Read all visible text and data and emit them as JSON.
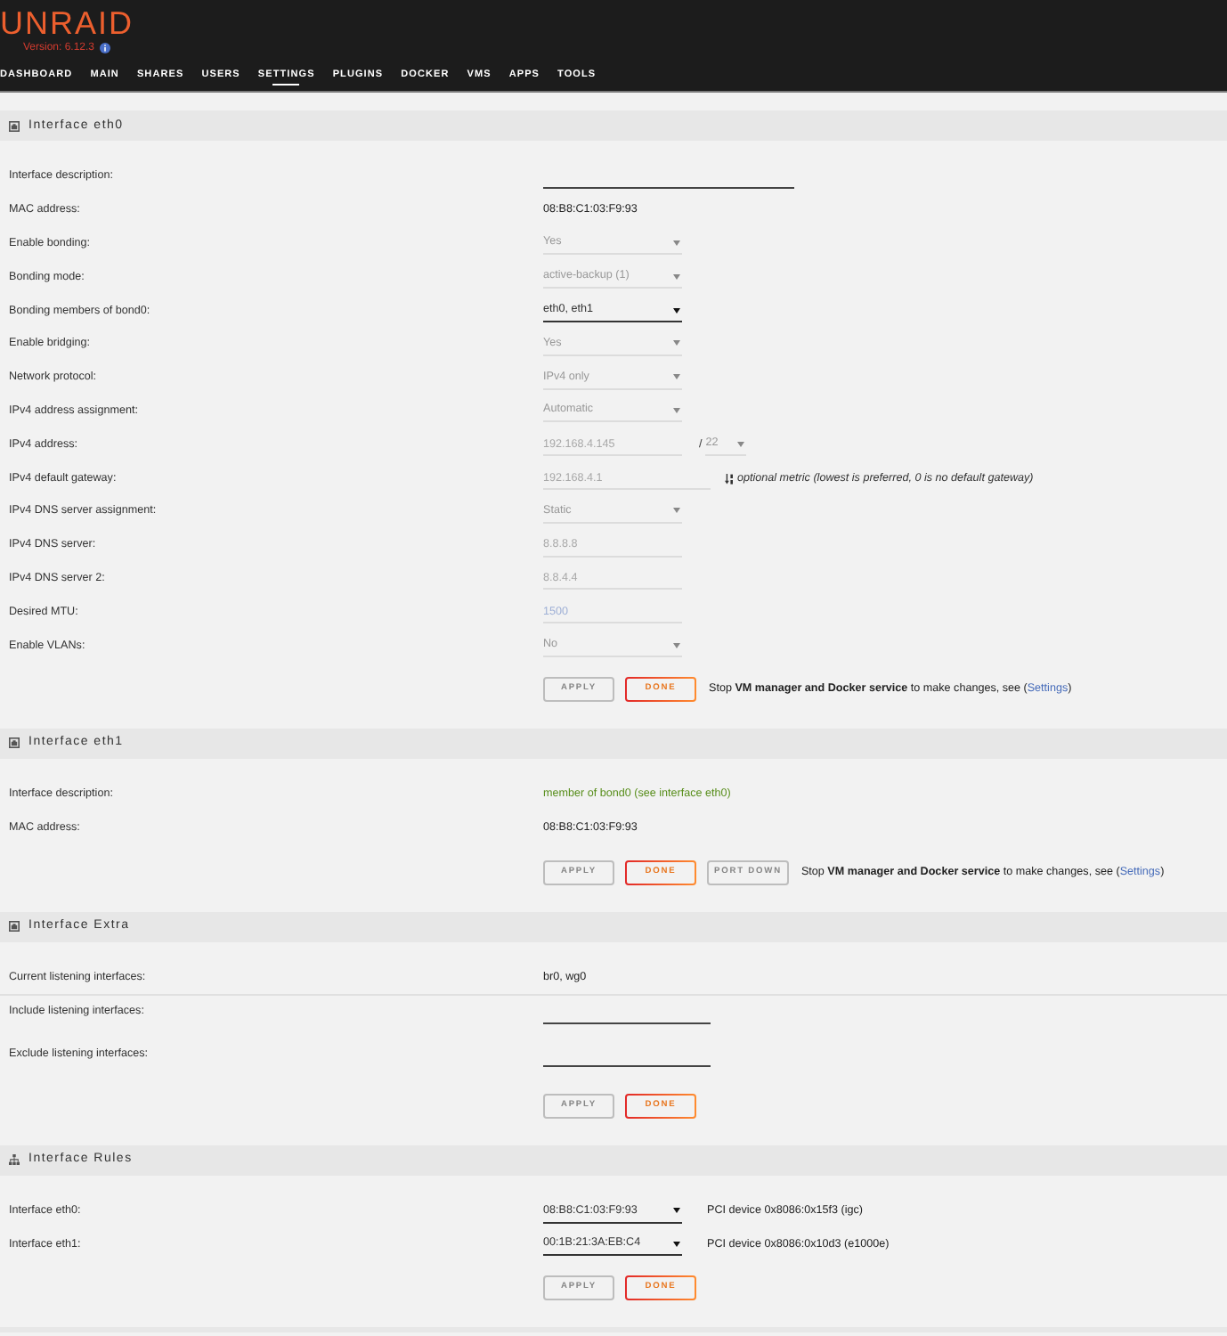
{
  "header": {
    "logo": "UNRAID",
    "version": "Version: 6.12.3",
    "nav": [
      {
        "label": "DASHBOARD",
        "selected": false
      },
      {
        "label": "MAIN",
        "selected": false
      },
      {
        "label": "SHARES",
        "selected": false
      },
      {
        "label": "USERS",
        "selected": false
      },
      {
        "label": "SETTINGS",
        "selected": true
      },
      {
        "label": "PLUGINS",
        "selected": false
      },
      {
        "label": "DOCKER",
        "selected": false
      },
      {
        "label": "VMS",
        "selected": false
      },
      {
        "label": "APPS",
        "selected": false
      },
      {
        "label": "TOOLS",
        "selected": false
      }
    ]
  },
  "sections": [
    {
      "kind": "interface",
      "title": "Interface eth0",
      "rows": [
        {
          "label": "Interface description:",
          "controls": [
            {
              "kind": "wide-input",
              "disabled": false
            }
          ]
        },
        {
          "label": "MAC address:",
          "controls": [
            {
              "kind": "text",
              "value": "08:B8:C1:03:F9:93"
            }
          ]
        },
        {
          "label": "Enable bonding:",
          "controls": [
            {
              "kind": "select",
              "value": "Yes",
              "disabled": true
            }
          ]
        },
        {
          "label": "Bonding mode:",
          "controls": [
            {
              "kind": "select",
              "value": "active-backup (1)",
              "disabled": true
            }
          ]
        },
        {
          "label": "Bonding members of bond0:",
          "controls": [
            {
              "kind": "select",
              "value": "eth0, eth1",
              "disabled": false
            }
          ]
        },
        {
          "label": "Enable bridging:",
          "controls": [
            {
              "kind": "select",
              "value": "Yes",
              "disabled": true
            }
          ]
        },
        {
          "label": "Network protocol:",
          "controls": [
            {
              "kind": "select",
              "value": "IPv4 only",
              "disabled": true
            }
          ]
        },
        {
          "label": "IPv4 address assignment:",
          "controls": [
            {
              "kind": "select",
              "value": "Automatic",
              "disabled": true
            }
          ]
        },
        {
          "label": "IPv4 address:",
          "controls": [
            {
              "kind": "input",
              "value": "192.168.4.145",
              "disabled": true
            },
            {
              "kind": "slash",
              "value": "/"
            },
            {
              "kind": "small-select",
              "value": "22",
              "disabled": true
            }
          ]
        },
        {
          "label": "IPv4 default gateway:",
          "controls": [
            {
              "kind": "input",
              "value": "192.168.4.1",
              "disabled": true
            },
            {
              "kind": "tiny-input",
              "disabled": true
            },
            {
              "kind": "hint",
              "value": "optional metric (lowest is preferred, 0 is no default gateway)"
            }
          ]
        },
        {
          "label": "IPv4 DNS server assignment:",
          "controls": [
            {
              "kind": "select",
              "value": "Static",
              "disabled": true
            }
          ]
        },
        {
          "label": "IPv4 DNS server:",
          "controls": [
            {
              "kind": "input",
              "value": "8.8.8.8",
              "disabled": true
            }
          ]
        },
        {
          "label": "IPv4 DNS server 2:",
          "controls": [
            {
              "kind": "input",
              "value": "8.8.4.4",
              "disabled": true
            }
          ]
        },
        {
          "label": "Desired MTU:",
          "controls": [
            {
              "kind": "input",
              "placeholder": "1500",
              "disabled": true
            }
          ]
        },
        {
          "label": "Enable VLANs:",
          "controls": [
            {
              "kind": "select",
              "value": "No",
              "disabled": true
            }
          ]
        }
      ],
      "buttons": [
        {
          "label": "APPLY",
          "disabled": true
        },
        {
          "label": "DONE",
          "disabled": false
        }
      ],
      "notice": {
        "text": "Stop **VM manager and Docker service** to make changes, see (",
        "link": "Settings",
        "text_after": ")"
      }
    },
    {
      "kind": "interface",
      "title": "Interface eth1",
      "rows": [
        {
          "label": "Interface description:",
          "controls": [
            {
              "kind": "status",
              "value": "member of bond0 (see interface eth0)"
            }
          ]
        },
        {
          "label": "MAC address:",
          "controls": [
            {
              "kind": "text",
              "value": "08:B8:C1:03:F9:93"
            }
          ]
        }
      ],
      "buttons": [
        {
          "label": "APPLY",
          "disabled": true
        },
        {
          "label": "DONE",
          "disabled": false
        },
        {
          "label": "PORT DOWN",
          "disabled": true
        }
      ],
      "notice": {
        "text": "Stop **VM manager and Docker service** to make changes, see (",
        "link": "Settings",
        "text_after": ")"
      }
    },
    {
      "kind": "interface",
      "title": "Interface Extra",
      "rows": [
        {
          "label": "Current listening interfaces:",
          "divider_after": true,
          "controls": [
            {
              "kind": "text",
              "value": "br0, wg0"
            }
          ]
        },
        {
          "label": "Include listening interfaces:",
          "controls": [
            {
              "kind": "medium-input",
              "disabled": false
            }
          ]
        },
        {
          "label": "Exclude listening interfaces:",
          "controls": [
            {
              "kind": "medium-input",
              "disabled": false
            }
          ]
        }
      ],
      "buttons": [
        {
          "label": "APPLY",
          "disabled": true
        },
        {
          "label": "DONE",
          "disabled": false
        }
      ]
    },
    {
      "kind": "mapping",
      "title": "Interface Rules",
      "rows": [
        {
          "label": "Interface eth0:",
          "controls": [
            {
              "kind": "select",
              "value": "08:B8:C1:03:F9:93",
              "disabled": false
            },
            {
              "kind": "text",
              "value": "PCI device 0x8086:0x15f3 (igc)"
            }
          ]
        },
        {
          "label": "Interface eth1:",
          "controls": [
            {
              "kind": "select",
              "value": "00:1B:21:3A:EB:C4",
              "disabled": false
            },
            {
              "kind": "text",
              "value": "PCI device 0x8086:0x10d3 (e1000e)"
            }
          ]
        }
      ],
      "buttons": [
        {
          "label": "APPLY",
          "disabled": true
        },
        {
          "label": "DONE",
          "disabled": false
        }
      ]
    }
  ]
}
